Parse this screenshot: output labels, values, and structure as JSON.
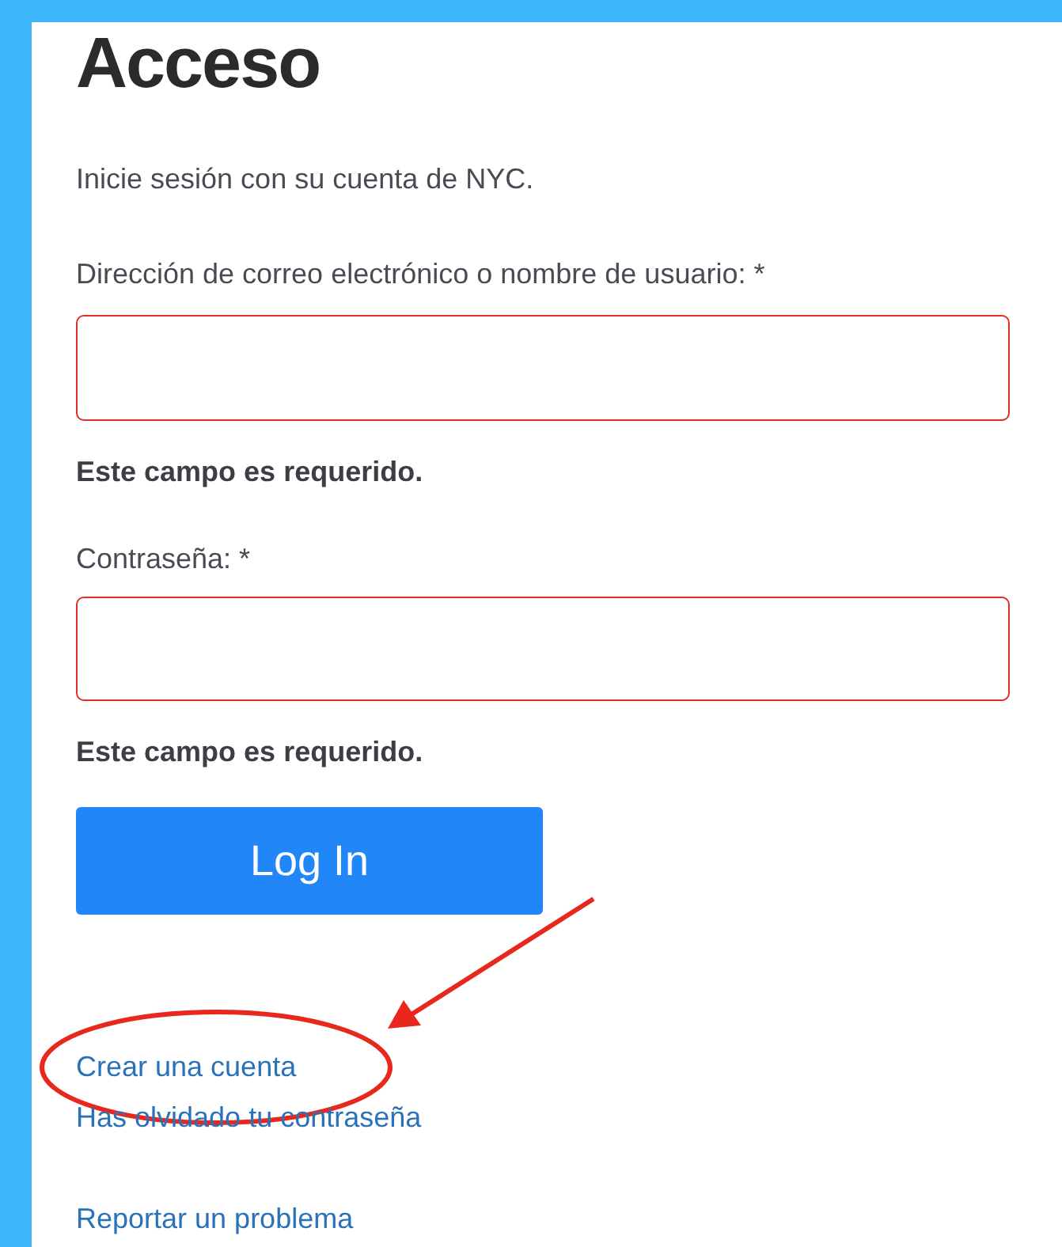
{
  "title": "Acceso",
  "intro": "Inicie sesión con su cuenta de NYC.",
  "fields": [
    {
      "label": "Dirección de correo electrónico o nombre de usuario: *",
      "invalid": true,
      "error": "Este campo es requerido."
    },
    {
      "label": "Contraseña: *",
      "invalid": true,
      "error": "Este campo es requerido."
    }
  ],
  "submit": "Log In",
  "links": [
    {
      "label": "Crear una cuenta",
      "circled": true
    },
    {
      "label": "Has olvidado tu contraseña",
      "circled": false
    },
    {
      "label": "Reportar un problema",
      "circled": false
    }
  ]
}
